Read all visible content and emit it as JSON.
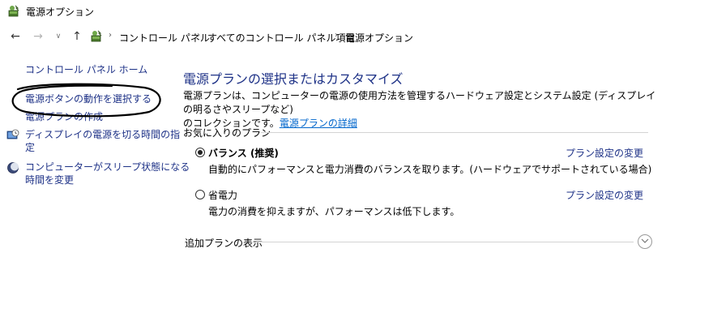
{
  "window": {
    "title": "電源オプション"
  },
  "addressbar": {
    "breadcrumbs": [
      "コントロール パネル",
      "すべてのコントロール パネル項目",
      "電源オプション"
    ]
  },
  "sidebar": {
    "home": "コントロール パネル ホーム",
    "items": [
      {
        "label": "電源ボタンの動作を選択する"
      },
      {
        "label": "電源プランの作成"
      },
      {
        "label_line1": "ディスプレイの電源を切る時間の指",
        "label_line2": "定"
      },
      {
        "label_line1": "コンピューターがスリープ状態になる",
        "label_line2": "時間を変更"
      }
    ]
  },
  "main": {
    "heading": "電源プランの選択またはカスタマイズ",
    "description_line1": "電源プランは、コンピューターの電源の使用方法を管理するハードウェア設定とシステム設定 (ディスプレイの明るさやスリープなど)",
    "description_line2_prefix": "のコレクションです。",
    "description_link": "電源プランの詳細",
    "favorites_label": "お気に入りのプラン",
    "plans": [
      {
        "name": "バランス (推奨)",
        "selected": true,
        "description": "自動的にパフォーマンスと電力消費のバランスを取ります。(ハードウェアでサポートされている場合)",
        "settings_link": "プラン設定の変更"
      },
      {
        "name": "省電力",
        "selected": false,
        "description": "電力の消費を抑えますが、パフォーマンスは低下します。",
        "settings_link": "プラン設定の変更"
      }
    ],
    "additional_plans_label": "追加プランの表示"
  }
}
